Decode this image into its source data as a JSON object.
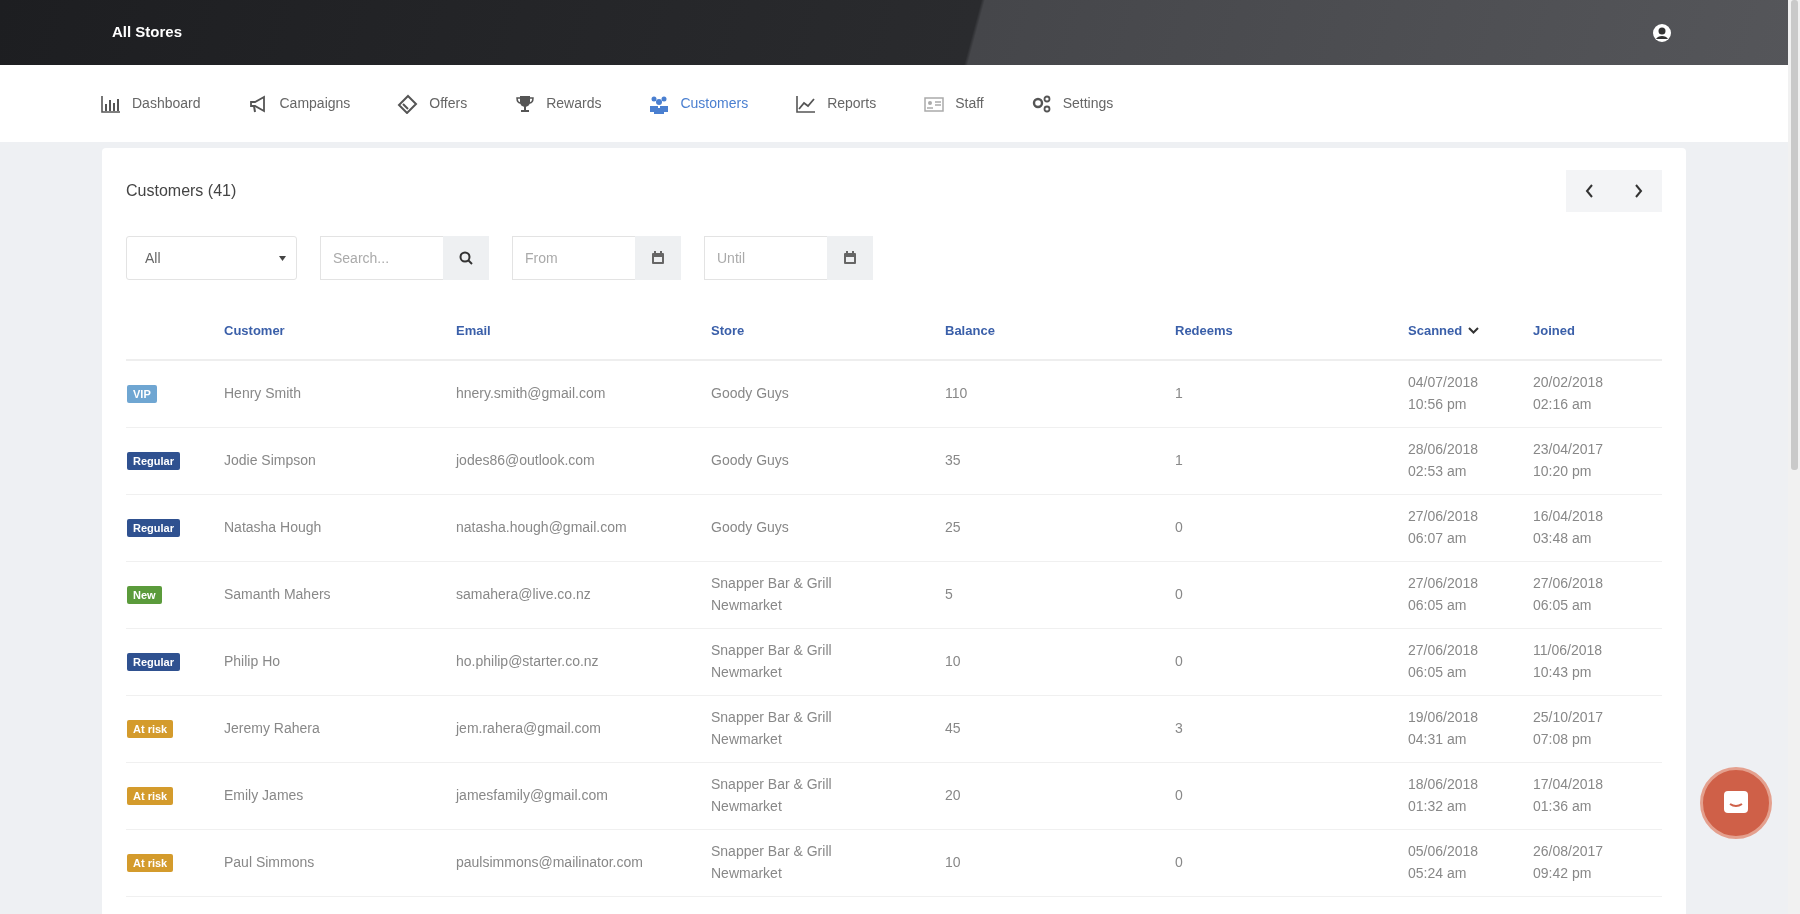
{
  "topbar": {
    "title": "All Stores"
  },
  "nav": [
    {
      "label": "Dashboard",
      "selected": false
    },
    {
      "label": "Campaigns",
      "selected": false
    },
    {
      "label": "Offers",
      "selected": false
    },
    {
      "label": "Rewards",
      "selected": false
    },
    {
      "label": "Customers",
      "selected": true
    },
    {
      "label": "Reports",
      "selected": false
    },
    {
      "label": "Staff",
      "selected": false
    },
    {
      "label": "Settings",
      "selected": false
    }
  ],
  "panel": {
    "title": "Customers (41)"
  },
  "filters": {
    "segment": "All",
    "search_placeholder": "Search...",
    "from_placeholder": "From",
    "until_placeholder": "Until"
  },
  "table": {
    "columns": [
      {
        "label": "Customer",
        "sorted": false
      },
      {
        "label": "Email",
        "sorted": false
      },
      {
        "label": "Store",
        "sorted": false
      },
      {
        "label": "Balance",
        "sorted": false
      },
      {
        "label": "Redeems",
        "sorted": false
      },
      {
        "label": "Scanned",
        "sorted": true
      },
      {
        "label": "Joined",
        "sorted": false
      }
    ],
    "rows": [
      {
        "tag": {
          "label": "VIP",
          "color": "#6fa6d2"
        },
        "customer": "Henry Smith",
        "email": "hnery.smith@gmail.com",
        "store": "Goody Guys",
        "balance": "110",
        "redeems": "1",
        "scanned": "04/07/2018 10:56 pm",
        "joined": "20/02/2018 02:16 am"
      },
      {
        "tag": {
          "label": "Regular",
          "color": "#2f5190"
        },
        "customer": "Jodie Simpson",
        "email": "jodes86@outlook.com",
        "store": "Goody Guys",
        "balance": "35",
        "redeems": "1",
        "scanned": "28/06/2018 02:53 am",
        "joined": "23/04/2017 10:20 pm"
      },
      {
        "tag": {
          "label": "Regular",
          "color": "#2f5190"
        },
        "customer": "Natasha Hough",
        "email": "natasha.hough@gmail.com",
        "store": "Goody Guys",
        "balance": "25",
        "redeems": "0",
        "scanned": "27/06/2018 06:07 am",
        "joined": "16/04/2018 03:48 am"
      },
      {
        "tag": {
          "label": "New",
          "color": "#5b9b3b"
        },
        "customer": "Samanth Mahers",
        "email": "samahera@live.co.nz",
        "store": "Snapper Bar & Grill Newmarket",
        "balance": "5",
        "redeems": "0",
        "scanned": "27/06/2018 06:05 am",
        "joined": "27/06/2018 06:05 am"
      },
      {
        "tag": {
          "label": "Regular",
          "color": "#2f5190"
        },
        "customer": "Philip Ho",
        "email": "ho.philip@starter.co.nz",
        "store": "Snapper Bar & Grill Newmarket",
        "balance": "10",
        "redeems": "0",
        "scanned": "27/06/2018 06:05 am",
        "joined": "11/06/2018 10:43 pm"
      },
      {
        "tag": {
          "label": "At risk",
          "color": "#d49b2c"
        },
        "customer": "Jeremy Rahera",
        "email": "jem.rahera@gmail.com",
        "store": "Snapper Bar & Grill Newmarket",
        "balance": "45",
        "redeems": "3",
        "scanned": "19/06/2018 04:31 am",
        "joined": "25/10/2017 07:08 pm"
      },
      {
        "tag": {
          "label": "At risk",
          "color": "#d49b2c"
        },
        "customer": "Emily James",
        "email": "jamesfamily@gmail.com",
        "store": "Snapper Bar & Grill Newmarket",
        "balance": "20",
        "redeems": "0",
        "scanned": "18/06/2018 01:32 am",
        "joined": "17/04/2018 01:36 am"
      },
      {
        "tag": {
          "label": "At risk",
          "color": "#d49b2c"
        },
        "customer": "Paul Simmons",
        "email": "paulsimmons@mailinator.com",
        "store": "Snapper Bar & Grill Newmarket",
        "balance": "10",
        "redeems": "0",
        "scanned": "05/06/2018 05:24 am",
        "joined": "26/08/2017 09:42 pm"
      }
    ]
  }
}
